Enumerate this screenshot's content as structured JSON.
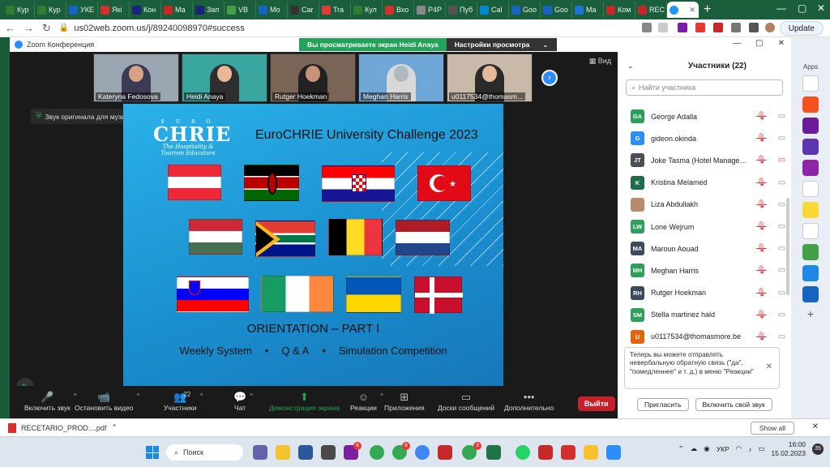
{
  "browser": {
    "tabs": [
      "Кур",
      "Кур",
      "УКЕ",
      "Які",
      "Кон",
      "Ма",
      "Зап",
      "VB",
      "Mo",
      "Car",
      "Tra",
      "Кул",
      "Вхо",
      "Р4Р",
      "Пуб",
      "Cal",
      "Goo",
      "Goo",
      "Ma",
      "Ком",
      "REC",
      ""
    ],
    "tab_colors": [
      "#2e7d32",
      "#2e7d32",
      "#1565c0",
      "#d32f2f",
      "#1a237e",
      "#c62828",
      "#1a237e",
      "#43a047",
      "#1565c0",
      "#333333",
      "#e53935",
      "#2e7d32",
      "#d32f2f",
      "#888888",
      "#555555",
      "#0288d1",
      "#1565c0",
      "#1565c0",
      "#1976d2",
      "#c62828",
      "#c62828",
      "#2196f3"
    ],
    "new_tab": "+",
    "address": "us02web.zoom.us/j/89240098970#success",
    "update_label": "Update"
  },
  "zoom": {
    "window_title": "Zoom Конференция",
    "share_banner": "Вы просматриваете экран Heidi Anaya",
    "view_options": "Настройки просмотра",
    "view_label": "Вид",
    "tooltip": "Звук оригинала для музыкантов выключен",
    "thumbnails": [
      {
        "name": "Kateryna Fedosova",
        "bg": "#9aa7b0",
        "skin": "#d9a383",
        "cloth": "#3b3b55"
      },
      {
        "name": "Heidi Anaya",
        "bg": "#3aa6a0",
        "skin": "#e6b894",
        "cloth": "#2e2e2e"
      },
      {
        "name": "Rutger Hoekman",
        "bg": "#7a6456",
        "skin": "#c89478",
        "cloth": "#222222"
      },
      {
        "name": "Meghan Harris",
        "bg": "#6fa7d8",
        "skin": "#b0b8c0",
        "cloth": "#d8d8d8"
      },
      {
        "name": "u0117534@thomasm...",
        "bg": "#c8b9a8",
        "skin": "#e4b99a",
        "cloth": "#2a2a2a"
      }
    ],
    "slide": {
      "logo_euro": "E U R O",
      "logo_chrie": "CHRIE",
      "logo_tag": "The Hospitality & Tourism Educators",
      "title": "EuroCHRIE University Challenge 2023",
      "orientation": "ORIENTATION – PART I",
      "items": [
        "Weekly System",
        "•",
        "Q & A",
        "•",
        "Simulation Competition"
      ]
    },
    "controls": [
      {
        "label": "Включить звук",
        "icon": "🎤"
      },
      {
        "label": "Остановить видео",
        "icon": "📹"
      },
      {
        "label": "Участники",
        "icon": "👥",
        "count": "22"
      },
      {
        "label": "Чат",
        "icon": "💬"
      },
      {
        "label": "Демонстрация экрана",
        "icon": "⬆"
      },
      {
        "label": "Реакции",
        "icon": "☺"
      },
      {
        "label": "Приложения",
        "icon": "⊞"
      },
      {
        "label": "Доски сообщений",
        "icon": "▭"
      },
      {
        "label": "Дополнительно",
        "icon": "•••"
      }
    ],
    "leave_label": "Выйти"
  },
  "participants": {
    "title": "Участники (22)",
    "search_placeholder": "Найти участника",
    "list": [
      {
        "initials": "GA",
        "name": "George Adalla",
        "color": "#2e9e5b",
        "cam_off": false
      },
      {
        "initials": "G",
        "name": "gideon.okinda",
        "color": "#2d8cff",
        "cam_off": false
      },
      {
        "initials": "JT",
        "name": "Joke Tasma (Hotel Management ...",
        "color": "#4a4f55",
        "cam_off": true
      },
      {
        "initials": "K",
        "name": "Kristina Melamed",
        "color": "#1f6b4a",
        "cam_off": false
      },
      {
        "initials": "",
        "name": "Liza Abdullakh",
        "color": "#b98b6e",
        "cam_off": false
      },
      {
        "initials": "LW",
        "name": "Lone Wejrum",
        "color": "#2e9e5b",
        "cam_off": false
      },
      {
        "initials": "MA",
        "name": "Maroun Aouad",
        "color": "#3c4a5e",
        "cam_off": false
      },
      {
        "initials": "MH",
        "name": "Meghan Harris",
        "color": "#2e9e5b",
        "cam_off": false
      },
      {
        "initials": "RH",
        "name": "Rutger Hoekman",
        "color": "#3c4a5e",
        "cam_off": false
      },
      {
        "initials": "SM",
        "name": "Stella martinez hald",
        "color": "#2e9e5b",
        "cam_off": false
      },
      {
        "initials": "U",
        "name": "u0117534@thomasmore.be",
        "color": "#e0650f",
        "cam_off": false
      }
    ],
    "notice": "Теперь вы можете отправлять невербальную обратную связь (\"да\", \"помедленнее\" и т. д.) в меню \"Реакции\"",
    "invite_label": "Пригласить",
    "unmute_label": "Включить свой звук"
  },
  "sidebar": {
    "apps_label": "Apps"
  },
  "downloads": {
    "file": "RECETARIO_PROD....pdf",
    "show_all": "Show all"
  },
  "taskbar": {
    "search": "Поиск",
    "lang": "УКР",
    "time": "16:00",
    "date": "15.02.2023",
    "notif_count": "35",
    "badges": [
      "6",
      "6",
      "3"
    ]
  }
}
